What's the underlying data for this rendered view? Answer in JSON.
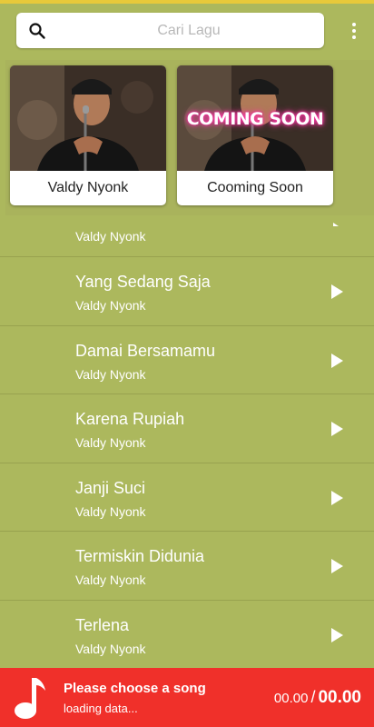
{
  "search": {
    "placeholder": "Cari Lagu"
  },
  "featured": [
    {
      "label": "Valdy Nyonk",
      "overlay": ""
    },
    {
      "label": "Cooming Soon",
      "overlay": "COMING SOON"
    }
  ],
  "songs": [
    {
      "title": "",
      "artist": "Valdy Nyonk"
    },
    {
      "title": "Yang Sedang Saja",
      "artist": "Valdy Nyonk"
    },
    {
      "title": "Damai Bersamamu",
      "artist": "Valdy Nyonk"
    },
    {
      "title": "Karena Rupiah",
      "artist": "Valdy Nyonk"
    },
    {
      "title": "Janji Suci",
      "artist": "Valdy Nyonk"
    },
    {
      "title": "Termiskin Didunia",
      "artist": "Valdy Nyonk"
    },
    {
      "title": "Terlena",
      "artist": "Valdy Nyonk"
    }
  ],
  "player": {
    "title": "Please choose a song",
    "status": "loading data...",
    "current_time": "00.00",
    "separator": "/",
    "total_time": "00.00"
  },
  "colors": {
    "background": "#acb85d",
    "player_bar": "#f0302a",
    "status_line": "#e8c93a"
  },
  "icons": {
    "search": "search-icon",
    "menu": "more-vert-icon",
    "play": "play-icon",
    "music": "music-note-icon"
  }
}
